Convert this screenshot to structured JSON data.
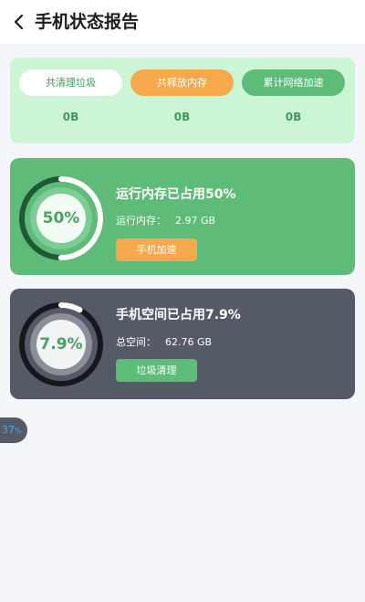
{
  "header": {
    "title": "手机状态报告",
    "back_icon": "chevron-left-icon"
  },
  "summary": {
    "tabs": [
      {
        "label": "共清理垃圾",
        "value": "0B"
      },
      {
        "label": "共释放内存",
        "value": "0B"
      },
      {
        "label": "累计网络加速",
        "value": "0B"
      }
    ]
  },
  "memory": {
    "percent": 50,
    "percent_label": "50%",
    "title": "运行内存已占用50%",
    "detail_label": "运行内存：",
    "detail_value": "2.97 GB",
    "button_label": "手机加速"
  },
  "storage": {
    "percent": 7.9,
    "percent_label": "7.9%",
    "title": "手机空间已占用7.9%",
    "detail_label": "总空间：",
    "detail_value": "62.76 GB",
    "button_label": "垃圾清理"
  },
  "floating_badge": {
    "value": "37",
    "unit": "%"
  },
  "colors": {
    "green_accent": "#5fbc78",
    "orange_accent": "#f6a84c",
    "dark_card": "#545b66",
    "summary_bg": "#cbf5d5"
  }
}
